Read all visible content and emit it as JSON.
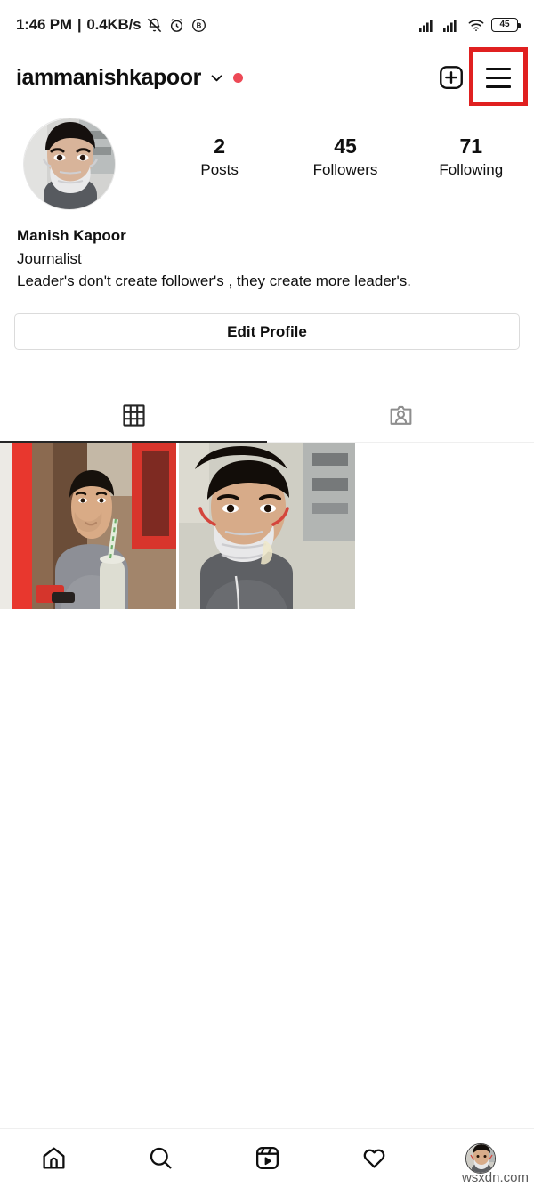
{
  "status_bar": {
    "time": "1:46 PM",
    "separator": "|",
    "network_speed": "0.4KB/s",
    "icons_left": [
      "bell-muted-icon",
      "alarm-clock-icon",
      "circled-b-icon"
    ],
    "icons_right": [
      "signal-bars-icon",
      "signal-bars-icon",
      "wifi-icon"
    ],
    "battery_level": "45"
  },
  "header": {
    "username": "iammanishkapoor",
    "chevron": "chevron-down-icon",
    "has_unread_dot": true,
    "dot_color": "#ED4956",
    "new_post_icon": "plus-square-icon",
    "menu_icon": "hamburger-menu-icon",
    "annotation_color": "#E02020"
  },
  "profile": {
    "avatar": "profile-photo",
    "stats": [
      {
        "value": "2",
        "label": "Posts"
      },
      {
        "value": "45",
        "label": "Followers"
      },
      {
        "value": "71",
        "label": "Following"
      }
    ],
    "full_name": "Manish Kapoor",
    "category": "Journalist",
    "bio": "Leader's don't create follower's , they create more leader's.",
    "edit_profile_label": "Edit Profile"
  },
  "tabs": [
    {
      "name": "grid-tab",
      "icon": "grid-icon",
      "active": true
    },
    {
      "name": "tagged-tab",
      "icon": "tagged-icon",
      "active": false
    }
  ],
  "posts": [
    {
      "alt": "post-thumbnail-man-with-drink"
    },
    {
      "alt": "post-thumbnail-man-wearing-mask"
    }
  ],
  "bottom_nav": [
    {
      "name": "home-icon"
    },
    {
      "name": "search-icon"
    },
    {
      "name": "reels-icon"
    },
    {
      "name": "activity-heart-icon"
    },
    {
      "name": "profile-avatar"
    }
  ],
  "watermark": "wsxdn.com"
}
